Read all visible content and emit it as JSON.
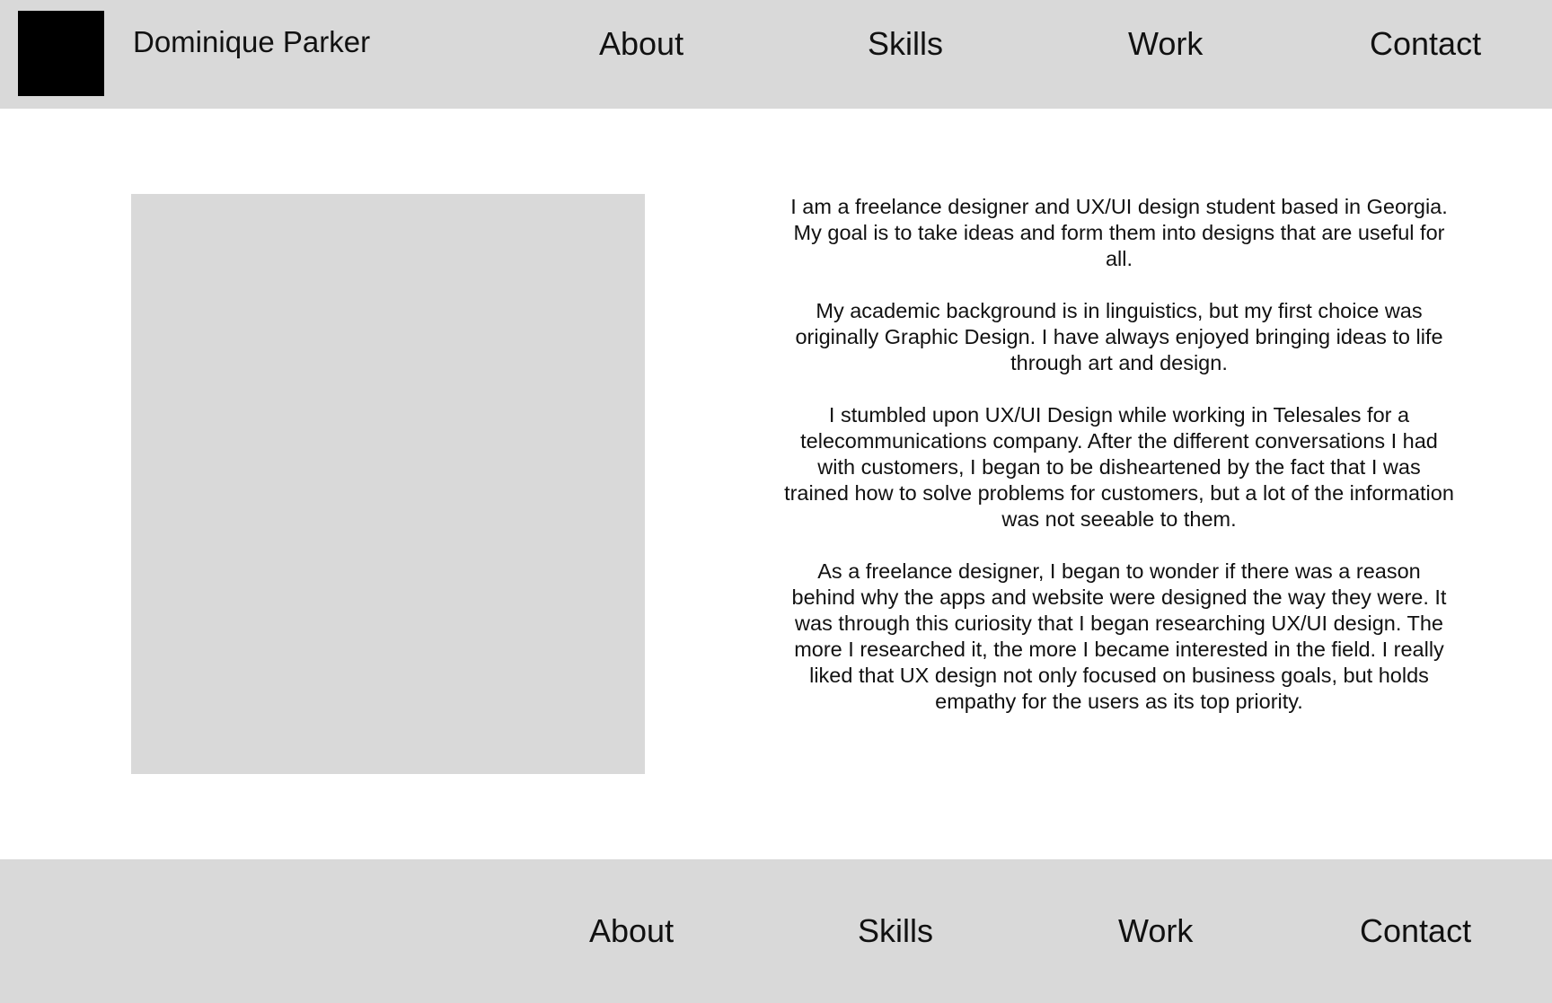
{
  "header": {
    "site_name": "Dominique Parker",
    "nav": [
      "About",
      "Skills",
      "Work",
      "Contact"
    ]
  },
  "bio": {
    "paragraphs": [
      "I am a freelance designer and UX/UI design student based in Georgia. My goal is to take ideas and form them into designs that are useful for all.",
      "My academic background is in linguistics, but my first choice was originally Graphic Design. I have always enjoyed bringing ideas to life through art and design.",
      "I stumbled upon UX/UI Design while working in Telesales for a telecommunications company. After the different conversations I had with customers, I began to be disheartened by the fact that I was trained how to solve problems for customers, but a lot of the information was not seeable to them.",
      "As a freelance designer, I began to wonder if there was a reason behind why the apps and website were designed the way they were. It was through this curiosity that I began researching UX/UI design. The more I researched it, the more I became interested in the field. I really liked that UX design not only focused on business goals, but holds empathy for the users as its top priority."
    ]
  },
  "footer": {
    "nav": [
      "About",
      "Skills",
      "Work",
      "Contact"
    ]
  },
  "colors": {
    "bar_background": "#d9d9d9",
    "logo": "#000000",
    "text": "#111111",
    "page_background": "#ffffff"
  }
}
